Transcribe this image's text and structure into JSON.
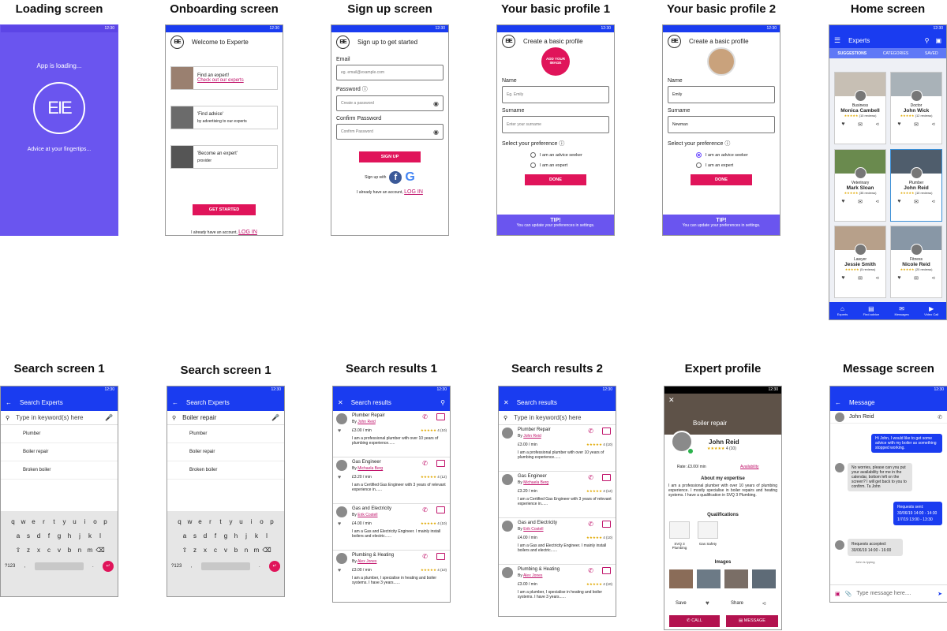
{
  "status_time": "12:30",
  "titles": {
    "loading": "Loading screen",
    "onboarding": "Onboarding screen",
    "signup": "Sign up screen",
    "profile1": "Your basic profile 1",
    "profile2": "Your basic profile 2",
    "home": "Home screen",
    "search1a": "Search screen 1",
    "search1b": "Search screen 1",
    "results1": "Search results 1",
    "results2": "Search results 2",
    "expert": "Expert profile",
    "message": "Message screen"
  },
  "loading": {
    "top": "App is loading...",
    "bottom": "Advice at your fingertips...",
    "logo": "EIE"
  },
  "onboarding": {
    "header": "Welcome to Experte",
    "cards": [
      {
        "line1": "Find an expert!",
        "line2": "Check out our experts",
        "link": true
      },
      {
        "line1": "'Find advice'",
        "line2": "by advertising to our experts",
        "link": false
      },
      {
        "line1": "'Become an expert'",
        "line2": "provider",
        "link": false
      }
    ],
    "button": "GET STARTED",
    "footer": "I already have an account,",
    "login": "LOG IN"
  },
  "signup": {
    "header": "Sign up to get started",
    "email_label": "Email",
    "email_ph": "eg. email@example.com",
    "password_label": "Password",
    "password_ph": "Create a password",
    "confirm_label": "Confirm Password",
    "confirm_ph": "Confirm Password",
    "button": "SIGN UP",
    "signup_with": "Sign up with",
    "footer": "I already have an account,",
    "login": "LOG IN"
  },
  "profile1": {
    "header": "Create a basic profile",
    "add_image": "ADD YOUR IMAGE",
    "name_label": "Name",
    "name_ph": "Eg. Emily",
    "surname_label": "Surname",
    "surname_ph": "Enter your surname",
    "pref_label": "Select your preference",
    "opt1": "I am an advice seeker",
    "opt2": "I am an expert",
    "button": "DONE",
    "tip_title": "TIP!",
    "tip_text": "You can update your preferences in settings."
  },
  "profile2": {
    "header": "Create a basic profile",
    "name_label": "Name",
    "name_val": "Emily",
    "surname_label": "Surname",
    "surname_val": "Newman",
    "pref_label": "Select your preference",
    "opt1": "I am an advice seeker",
    "opt2": "I am an expert",
    "button": "DONE",
    "tip_title": "TIP!",
    "tip_text": "You can update your preferences in settings."
  },
  "home": {
    "app_title": "Experts",
    "tabs": [
      "SUGGESTIONS",
      "CATEGORIES",
      "SAVED"
    ],
    "cards": [
      {
        "cat": "Business",
        "name": "Monica Cambell",
        "reviews": "(10 reviews)"
      },
      {
        "cat": "Doctor",
        "name": "John Wick",
        "reviews": "(12 reviews)"
      },
      {
        "cat": "Veterinary",
        "name": "Mark Sloan",
        "reviews": "(35 reviews)"
      },
      {
        "cat": "Plumber",
        "name": "John Reid",
        "reviews": "(10 reviews)"
      },
      {
        "cat": "Lawyer",
        "name": "Jessie Smith",
        "reviews": "(5 reviews)"
      },
      {
        "cat": "Fitness",
        "name": "Nicole Reid",
        "reviews": "(20 reviews)"
      }
    ],
    "nav": [
      "Experts",
      "Find advice",
      "Messages",
      "Video Call"
    ]
  },
  "search1a": {
    "title": "Search Experts",
    "placeholder": "Type in keyword(s) here",
    "suggestions": [
      "Plumber",
      "Boiler repair",
      "Broken boiler"
    ],
    "key123": "?123"
  },
  "search1b": {
    "title": "Search Experts",
    "value": "Boiler repair",
    "suggestions": [
      "Plumber",
      "Boiler repair",
      "Broken boiler"
    ],
    "key123": "?123"
  },
  "keyboard": {
    "row1": [
      "q",
      "w",
      "e",
      "r",
      "t",
      "y",
      "u",
      "i",
      "o",
      "p"
    ],
    "row2": [
      "a",
      "s",
      "d",
      "f",
      "g",
      "h",
      "j",
      "k",
      "l"
    ],
    "row3": [
      "z",
      "x",
      "c",
      "v",
      "b",
      "n",
      "m"
    ]
  },
  "results": {
    "title": "Search results",
    "placeholder": "Type in keyword(s) here",
    "items": [
      {
        "title": "Plumber Repair",
        "by": "By",
        "who": "John Reid",
        "price": "£3.00 / min",
        "rating": "4 (10)",
        "desc": "I am a professional plumber with over 10 years of plumbing experience......"
      },
      {
        "title": "Gas Engineer",
        "by": "By",
        "who": "Michaela Berg",
        "price": "£3.20 / min",
        "rating": "4 (12)",
        "desc": "I am a Certified Gas Engineer with 3 years of relevant experience in......"
      },
      {
        "title": "Gas and Electricity",
        "by": "By",
        "who": "Erik Costell",
        "price": "£4.00 / min",
        "rating": "4 (10)",
        "desc": "I am a Gas and Electricity Engineer. I mainly install boilers and electric......"
      },
      {
        "title": "Plumbing & Heating",
        "by": "By",
        "who": "Alex Jones",
        "price": "£3.00 / min",
        "rating": "4 (10)",
        "desc": "I am a plumber, I specialise in heating and boiler systems. I have 3 years......"
      }
    ]
  },
  "expert": {
    "banner": "Boiler repair",
    "name": "John Reid",
    "rating": "4 (10)",
    "rate": "Rate: £3.00/ min",
    "availability": "Availability",
    "about_title": "About my expertise",
    "about": "I am a professional plumber with over 10 years of plumbing experience. I mostly specialise in boiler repairs and heating systems. I have a qualification in SVQ 3 Plumbing.",
    "qual_title": "Qualifications",
    "quals": [
      "SVQ 3 Plumbing",
      "Gas Safety"
    ],
    "images_title": "Images",
    "save": "Save",
    "share": "Share",
    "call": "CALL",
    "message": "MESSAGE"
  },
  "message": {
    "title": "Message",
    "contact": "John Reid",
    "m1": "Hi John, I would like to get some advice with my boiler as something stopped working.",
    "m2": "No worries, please can you put your availability for me in the calendar, bottom left on the screen? I will get back to you to confirm. Ta John",
    "m3_title": "Requests sent:",
    "m3_l1": "30/06/19 14:00 - 14:30",
    "m3_l2": "1/7/19 13:00 - 13:30",
    "m4_title": "Requests accepted:",
    "m4_l1": "30/06/19 14:00 - 16:00",
    "typing": "John is typing",
    "input_ph": "Type message here...."
  },
  "colors": {
    "primary": "#1a3cf0",
    "accent": "#e0145a",
    "purple": "#6a55ef",
    "link": "#c0126a"
  }
}
